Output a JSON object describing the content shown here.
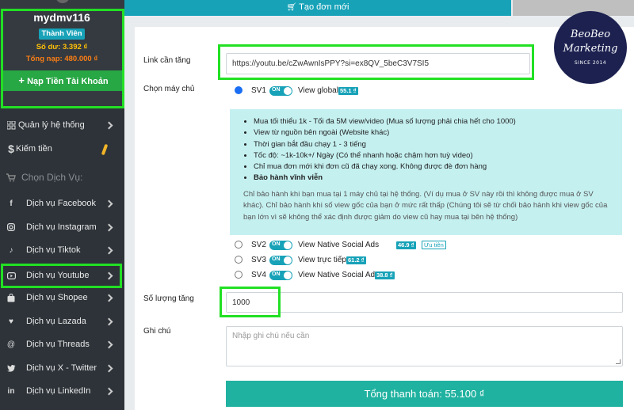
{
  "sidebar": {
    "username": "mydmv116",
    "role": "Thành Viên",
    "balance": "Số dư: 3.392 ₫",
    "total_topup": "Tổng nạp: 480.000 ₫",
    "topup_button": "Nạp Tiền Tài Khoản",
    "items": [
      {
        "label": "Quản lý hệ thống",
        "icon": "grid-icon"
      },
      {
        "label": "Kiếm tiền",
        "icon": "dollar-icon"
      },
      {
        "label": "Chọn Dịch Vụ:",
        "icon": "cart-icon"
      },
      {
        "label": "Dịch vụ Facebook",
        "icon": "facebook-icon"
      },
      {
        "label": "Dịch vụ Instagram",
        "icon": "instagram-icon"
      },
      {
        "label": "Dịch vụ Tiktok",
        "icon": "tiktok-icon"
      },
      {
        "label": "Dịch vụ Youtube",
        "icon": "youtube-icon"
      },
      {
        "label": "Dịch vụ Shopee",
        "icon": "shopee-icon"
      },
      {
        "label": "Dịch vụ Lazada",
        "icon": "lazada-icon"
      },
      {
        "label": "Dịch vụ Threads",
        "icon": "threads-icon"
      },
      {
        "label": "Dịch vụ X - Twitter",
        "icon": "twitter-icon"
      },
      {
        "label": "Dịch vụ LinkedIn",
        "icon": "linkedin-icon"
      }
    ]
  },
  "tabs": {
    "create_order": "Tạo đơn mới"
  },
  "form": {
    "link_label": "Link cần tăng",
    "link_value": "https://youtu.be/cZwAwnIsPPY?si=ex8QV_5beC3V7SI5",
    "server_label": "Chọn máy chủ",
    "quantity_label": "Số lượng tăng",
    "quantity_value": "1000",
    "note_label": "Ghi chú",
    "note_placeholder": "Nhập ghi chú nếu cần",
    "pay_button": "Tổng thanh toán: 55.100  ₫"
  },
  "servers": [
    {
      "code": "SV1",
      "toggle": "ON",
      "name": "View global",
      "price": "55.1 ₫",
      "selected": true
    },
    {
      "code": "SV2",
      "toggle": "ON",
      "name": "View Native Social Ads",
      "price": "46.9 ₫",
      "tag": "Ưu tiên"
    },
    {
      "code": "SV3",
      "toggle": "ON",
      "name": "View trực tiếp",
      "price": "61.2 ₫"
    },
    {
      "code": "SV4",
      "toggle": "ON",
      "name": "View Native Social Ads",
      "price": "38.8 ₫"
    }
  ],
  "info": {
    "bullets": [
      "Mua tối thiểu 1k - Tối đa 5M view/video (Mua số lượng phải chia hết cho 1000)",
      "View từ nguồn bên ngoài (Website khác)",
      "Thời gian bắt đầu chạy 1 - 3 tiếng",
      "Tốc độ: ~1k-10k+/ Ngày (Có thể nhanh hoặc chậm hơn tuỳ video)",
      "Chỉ mua đơn mới khi đơn cũ đã chạy xong. Không được đè đơn hàng",
      "Bảo hành vĩnh viễn"
    ],
    "note": "Chỉ bảo hành khi bạn mua tại 1 máy chủ tại hệ thống. (Ví dụ mua ở SV này rồi thì không được mua ở SV khác). Chỉ bảo hành khi số view gốc của bạn ở mức rất thấp (Chúng tôi sẽ từ chối bảo hành khi view gốc của bạn lớn vì sẽ không thể xác định được giảm do view cũ hay mua tại bên hệ thống)"
  },
  "logo": {
    "line1": "BeoBeo",
    "line2": "Marketing",
    "line3": "SINCE 2014"
  },
  "colors": {
    "sidebar_bg": "#2d3339",
    "accent": "#17a2b8",
    "success": "#28a745",
    "highlight": "#22e024",
    "pay_button": "#20b2a0"
  }
}
